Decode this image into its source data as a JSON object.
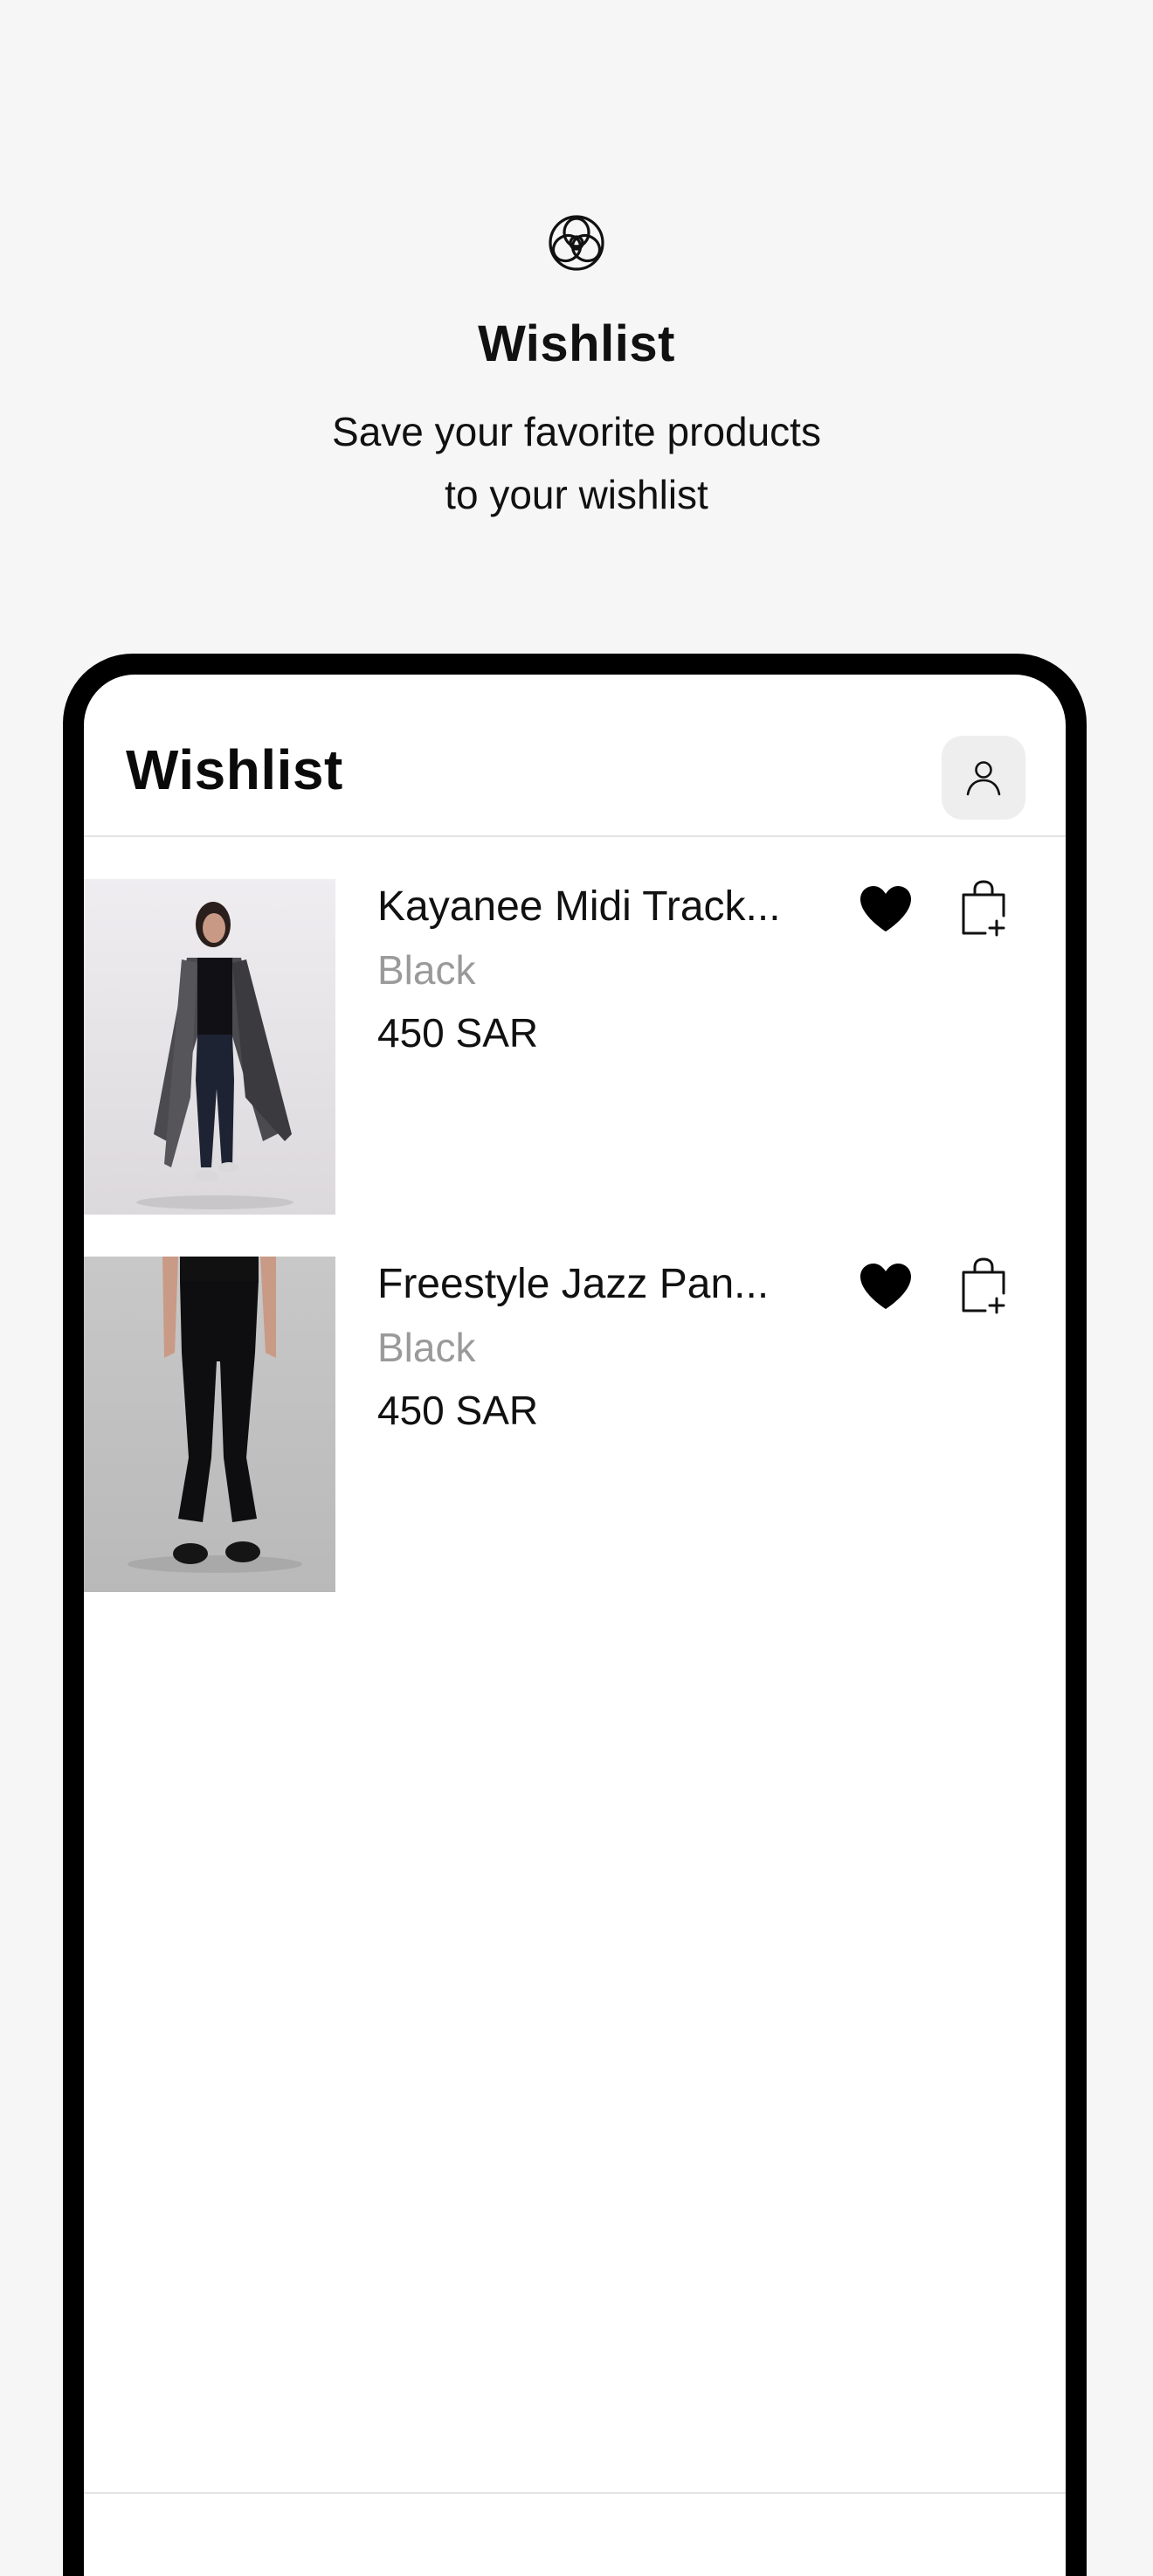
{
  "hero": {
    "logo_icon": "brand-knot-icon",
    "title": "Wishlist",
    "subtitle_line1": "Save your favorite products",
    "subtitle_line2": "to your wishlist"
  },
  "header": {
    "title": "Wishlist",
    "profile_icon": "user-icon"
  },
  "items": [
    {
      "name": "Kayanee Midi Track...",
      "variant": "Black",
      "price": "450 SAR",
      "heart_icon": "heart-filled-icon",
      "bag_icon": "bag-add-icon"
    },
    {
      "name": "Freestyle Jazz Pan...",
      "variant": "Black",
      "price": "450 SAR",
      "heart_icon": "heart-filled-icon",
      "bag_icon": "bag-add-icon"
    }
  ],
  "colors": {
    "background": "#f6f6f6",
    "device_frame": "#000000",
    "muted_text": "#9a9a9a",
    "divider": "#e4e4e4"
  }
}
